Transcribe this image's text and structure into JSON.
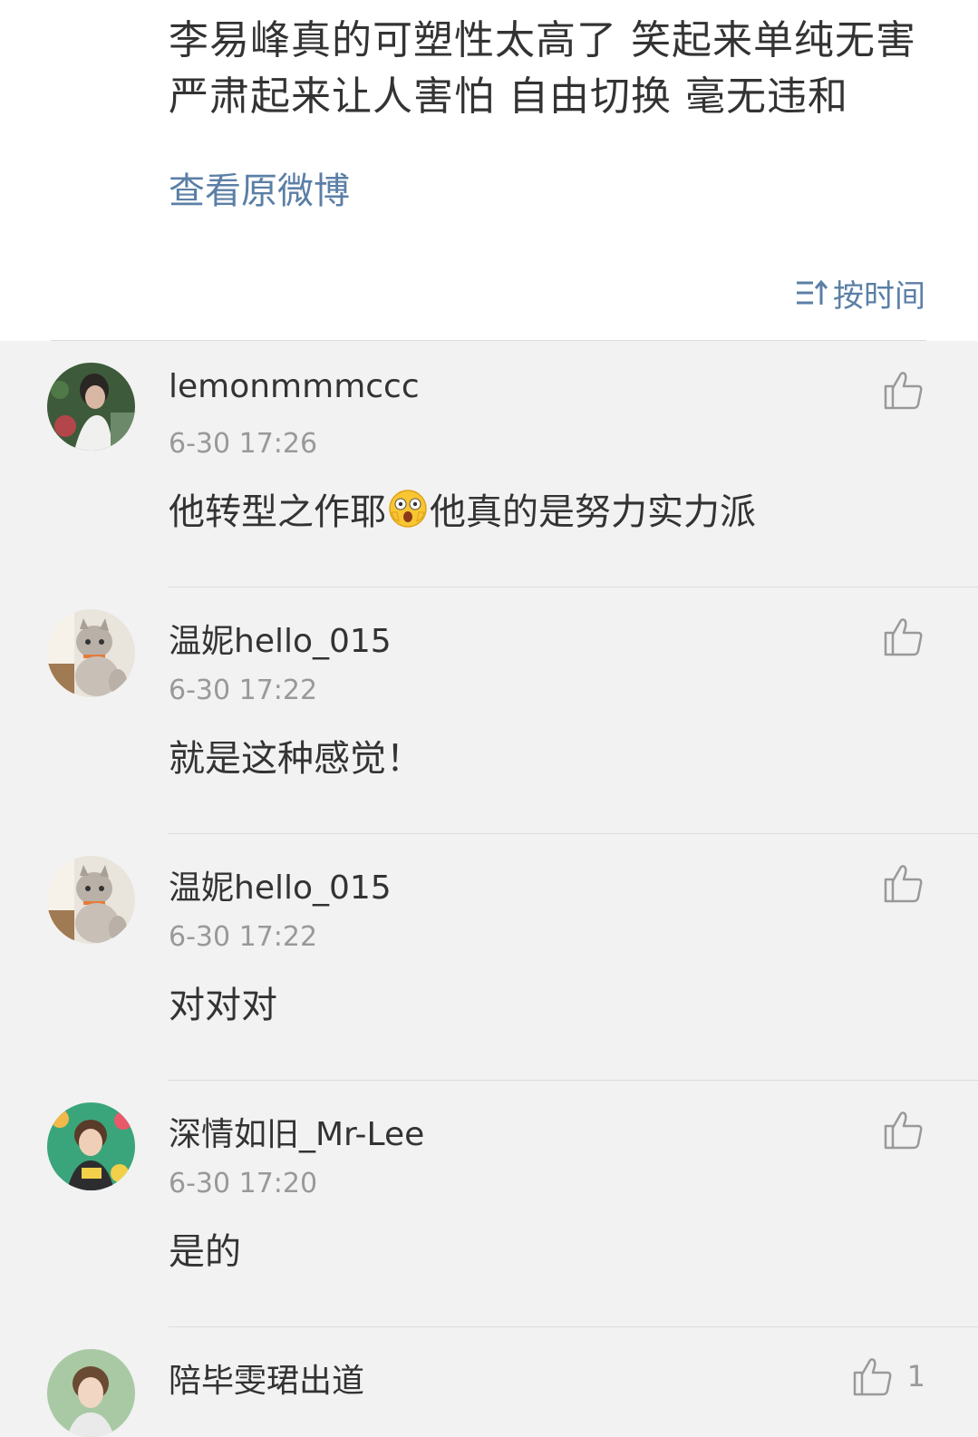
{
  "post": {
    "text": "李易峰真的可塑性太高了 笑起来单纯无害 严肃起来让人害怕 自由切换 毫无违和",
    "view_original": "查看原微博",
    "sort_label": "按时间"
  },
  "comments": [
    {
      "username": "lemonmmmccc",
      "time": "6-30 17:26",
      "text_before": "他转型之作耶",
      "emoji": "surprised-face-emoji",
      "text_after": "他真的是努力实力派",
      "likes": ""
    },
    {
      "username": "温妮hello_015",
      "time": "6-30 17:22",
      "text_before": "就是这种感觉！",
      "likes": ""
    },
    {
      "username": "温妮hello_015",
      "time": "6-30 17:22",
      "text_before": "对对对",
      "likes": ""
    },
    {
      "username": "深情如旧_Mr-Lee",
      "time": "6-30 17:20",
      "text_before": "是的",
      "likes": ""
    },
    {
      "username": "陪毕雯珺出道",
      "time": "",
      "text_before": "",
      "likes": "1"
    }
  ],
  "icons": {
    "like": "thumbs-up-icon",
    "sort": "sort-ascending-icon"
  },
  "colors": {
    "link": "#5b7fa6",
    "background": "#f2f2f2",
    "post_background": "#ffffff",
    "secondary_text": "#999999"
  }
}
